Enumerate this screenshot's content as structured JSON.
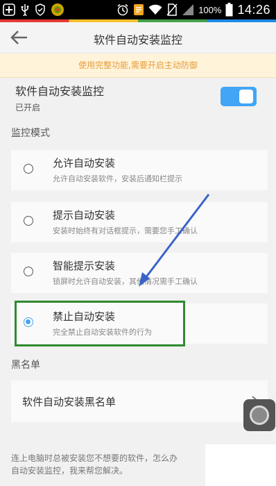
{
  "status_bar": {
    "battery_percent": "100%",
    "time": "14:26",
    "icons": [
      "add-icon",
      "usb-icon",
      "shield-icon",
      "app-icon",
      "alarm-icon",
      "notes-icon",
      "wifi-icon",
      "no-sim-icon",
      "signal-icon",
      "battery-icon"
    ]
  },
  "app_bar": {
    "title": "软件自动安装监控"
  },
  "banner": {
    "text": "使用完整功能,需要开启主动防御"
  },
  "monitor": {
    "title": "软件自动安装监控",
    "status": "已开启",
    "enabled": true
  },
  "mode": {
    "label": "监控模式",
    "options": [
      {
        "title": "允许自动安装",
        "desc": "允许自动安装软件，安装后通知栏提示",
        "checked": false
      },
      {
        "title": "提示自动安装",
        "desc": "安装时始终有对话框提示，需要您手工确认",
        "checked": false
      },
      {
        "title": "智能提示安装",
        "desc": "锁屏时允许自动安装，其他情况需手工确认",
        "checked": false
      },
      {
        "title": "禁止自动安装",
        "desc": "完全禁止自动安装软件的行为",
        "checked": true
      }
    ]
  },
  "blacklist": {
    "label": "黑名单",
    "item": "软件自动安装黑名单"
  },
  "footer": {
    "line1": "连上电脑时总被安装您不想要的软件，怎么办",
    "line2": "自动安装监控，我来帮您解决。"
  },
  "colors": {
    "accent": "#42a5f5",
    "banner_text": "#e79b3c",
    "highlight": "#2f8a2f",
    "arrow": "#3a63c9"
  }
}
